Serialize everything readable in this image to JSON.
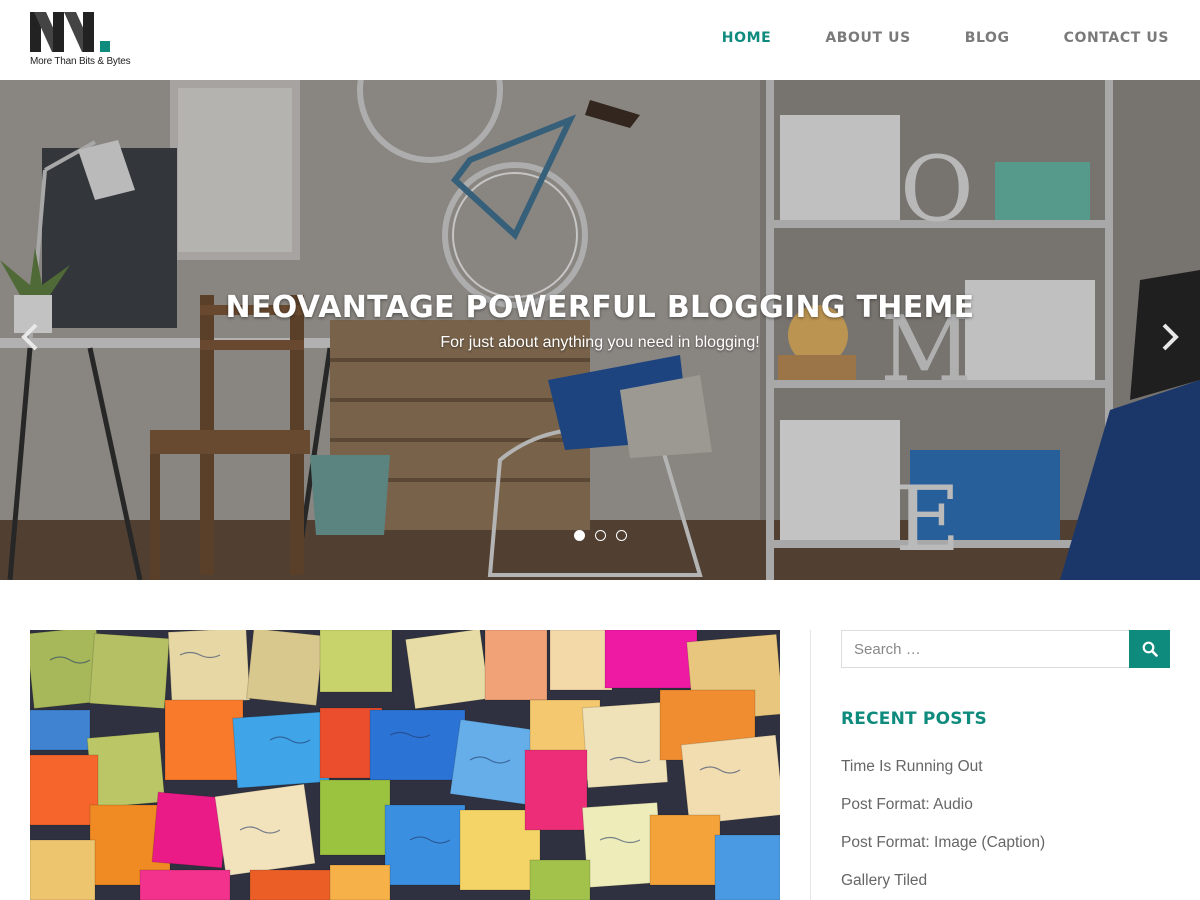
{
  "site": {
    "logo_tagline": "More Than Bits & Bytes",
    "accent_color": "#0f8b7e"
  },
  "nav": {
    "items": [
      {
        "label": "HOME",
        "active": true
      },
      {
        "label": "ABOUT US",
        "active": false
      },
      {
        "label": "BLOG",
        "active": false
      },
      {
        "label": "CONTACT US",
        "active": false
      }
    ]
  },
  "hero": {
    "title": "NEOVANTAGE POWERFUL BLOGGING THEME",
    "subtitle": "For just about anything you need in blogging!",
    "slide_count": 3,
    "active_slide": 1,
    "prev_icon": "chevron-left-icon",
    "next_icon": "chevron-right-icon"
  },
  "sidebar": {
    "search": {
      "placeholder": "Search …",
      "value": "",
      "icon": "search-icon"
    },
    "recent_posts": {
      "title": "RECENT POSTS",
      "items": [
        {
          "label": "Time Is Running Out"
        },
        {
          "label": "Post Format: Audio"
        },
        {
          "label": "Post Format: Image (Caption)"
        },
        {
          "label": "Gallery Tiled"
        }
      ]
    }
  }
}
